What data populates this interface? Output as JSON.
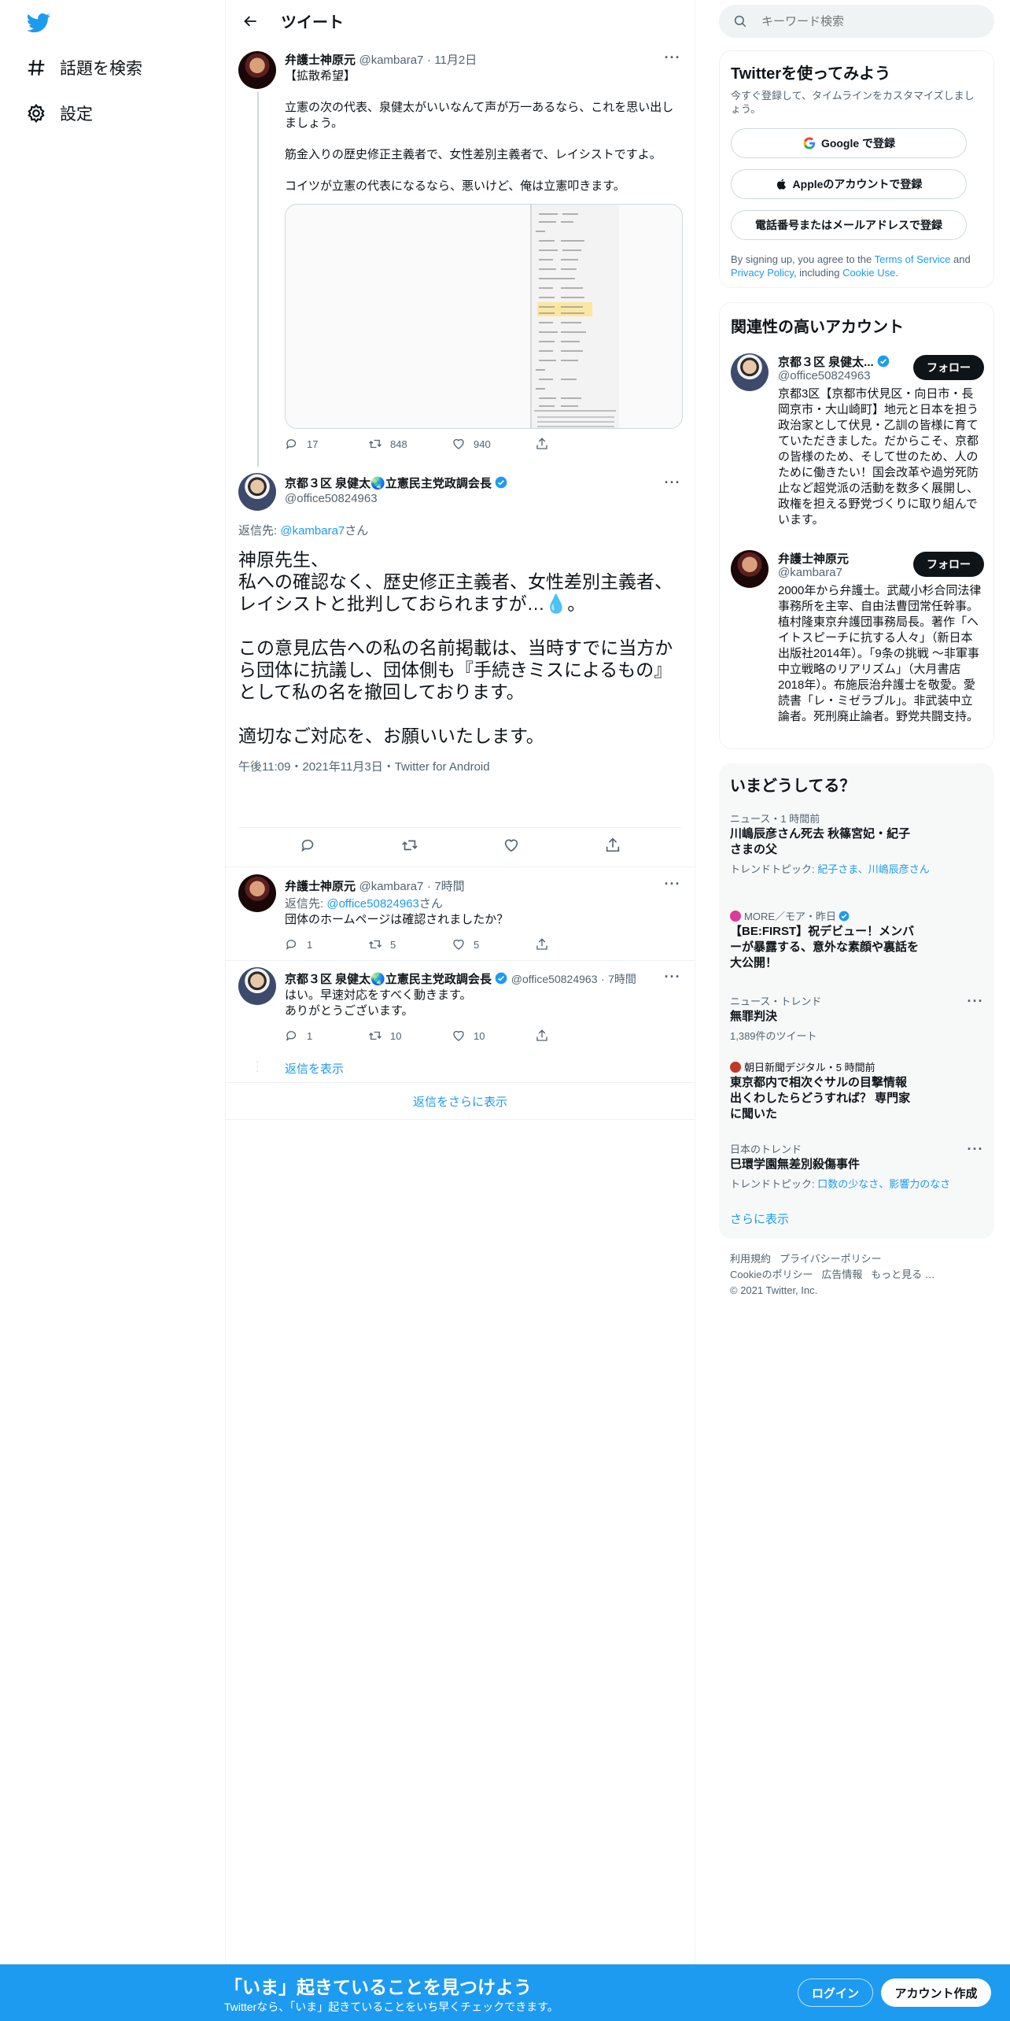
{
  "nav": {
    "explore_label": "話題を検索",
    "settings_label": "設定"
  },
  "header": {
    "title": "ツイート"
  },
  "tweet1": {
    "name": "弁護士神原元",
    "handle": "@kambara7",
    "date": "11月2日",
    "text": "【拡散希望】\n\n立憲の次の代表、泉健太がいいなんて声が万一あるなら、これを思い出しましょう。\n\n筋金入りの歴史修正主義者で、女性差別主義者で、レイシストですよ。\n\nコイツが立憲の代表になるなら、悪いけど、俺は立憲叩きます。",
    "replies": "17",
    "retweets": "848",
    "likes": "940"
  },
  "main_tweet": {
    "name": "京都３区 泉健太🌏立憲民主党政調会長",
    "handle": "@office50824963",
    "reply_to_prefix": "返信先: ",
    "reply_to_handle": "@kambara7",
    "reply_to_suffix": "さん",
    "text": "神原先生、\n私への確認なく、歴史修正主義者、女性差別主義者、レイシストと批判しておられますが…💧。\n\nこの意見広告への私の名前掲載は、当時すでに当方から団体に抗議し、団体側も『手続きミスによるもの』として私の名を撤回しております。\n\n適切なご対応を、お願いいたします。",
    "meta": "午後11:09・2021年11月3日・Twitter for Android"
  },
  "reply1": {
    "name": "弁護士神原元",
    "handle": "@kambara7",
    "time": "7時間",
    "reply_to_prefix": "返信先: ",
    "reply_to_handle": "@office50824963",
    "reply_to_suffix": "さん",
    "text": "団体のホームページは確認されましたか？",
    "replies": "1",
    "retweets": "5",
    "likes": "5"
  },
  "reply2": {
    "name": "京都３区 泉健太🌏立憲民主党政調会長",
    "handle": "@office50824963",
    "time": "7時間",
    "text": "はい。早速対応をすべく動きます。\nありがとうございます。",
    "replies": "1",
    "retweets": "10",
    "likes": "10",
    "show_replies": "返信を表示"
  },
  "more_replies": "返信をさらに表示",
  "search": {
    "placeholder": "キーワード検索"
  },
  "signup": {
    "title": "Twitterを使ってみよう",
    "subtitle": "今すぐ登録して、タイムラインをカスタマイズしましょう。",
    "google": "Google で登録",
    "apple": "Appleのアカウントで登録",
    "phone": "電話番号またはメールアドレスで登録",
    "legal_1": "By signing up, you agree to the ",
    "tos": "Terms of Service",
    "legal_2": " and ",
    "privacy": "Privacy Policy",
    "legal_3": ", including ",
    "cookie": "Cookie Use",
    "legal_4": "."
  },
  "related": {
    "title": "関連性の高いアカウント",
    "follow_label": "フォロー",
    "accounts": [
      {
        "name": "京都３区 泉健太...",
        "handle": "@office50824963",
        "bio": "京都3区【京都市伏見区・向日市・長岡京市・大山崎町】地元と日本を担う政治家として伏見・乙訓の皆様に育てていただきました。だからこそ、京都の皆様のため、そして世のため、人のために働きたい！国会改革や過労死防止など超党派の活動を数多く展開し、政権を担える野党づくりに取り組んでいます。"
      },
      {
        "name": "弁護士神原元",
        "handle": "@kambara7",
        "bio": "2000年から弁護士。武蔵小杉合同法律事務所を主宰、自由法曹団常任幹事。植村隆東京弁護団事務局長。著作「ヘイトスピーチに抗する人々」（新日本出版社2014年）。「9条の挑戦 ～非軍事中立戦略のリアリズム」（大月書店2018年）。布施辰治弁護士を敬愛。愛読書「レ・ミゼラブル」。非武装中立論者。死刑廃止論者。野党共闘支持。"
      }
    ]
  },
  "trends": {
    "title": "いまどうしてる？",
    "items": [
      {
        "category": "ニュース・1 時間前",
        "title": "川嶋辰彦さん死去 秋篠宮妃・紀子さまの父",
        "topics_label": "トレンドトピック: ",
        "topics": "紀子さま、川嶋辰彦さん"
      },
      {
        "category": "MORE／モア・昨日",
        "title": "【BE:FIRST】祝デビュー！メンバーが暴露する、意外な素顔や裏話を大公開！"
      },
      {
        "category": "ニュース・トレンド",
        "title": "無罪判決",
        "count": "1,389件のツイート"
      },
      {
        "category": "朝日新聞デジタル・5 時間前",
        "title": "東京都内で相次ぐサルの目撃情報 出くわしたらどうすれば？ 専門家に聞いた"
      },
      {
        "category": "日本のトレンド",
        "title": "巳環学園無差別殺傷事件",
        "topics_label": "トレンドトピック: ",
        "topics": "口数の少なさ、影響力のなさ"
      }
    ],
    "show_more": "さらに表示"
  },
  "footer": {
    "line1a": "利用規約",
    "line1b": "プライバシーポリシー",
    "line2a": "Cookieのポリシー",
    "line2b": "広告情報",
    "line2c": "もっと見る …",
    "copyright": "© 2021 Twitter, Inc."
  },
  "bottom_bar": {
    "headline": "「いま」起きていることを見つけよう",
    "sub": "Twitterなら、「いま」起きていることをいち早くチェックできます。",
    "login": "ログイン",
    "signup": "アカウント作成"
  },
  "colors": {
    "accent": "#1d9bf0",
    "text": "#0f1419",
    "muted": "#536471"
  }
}
